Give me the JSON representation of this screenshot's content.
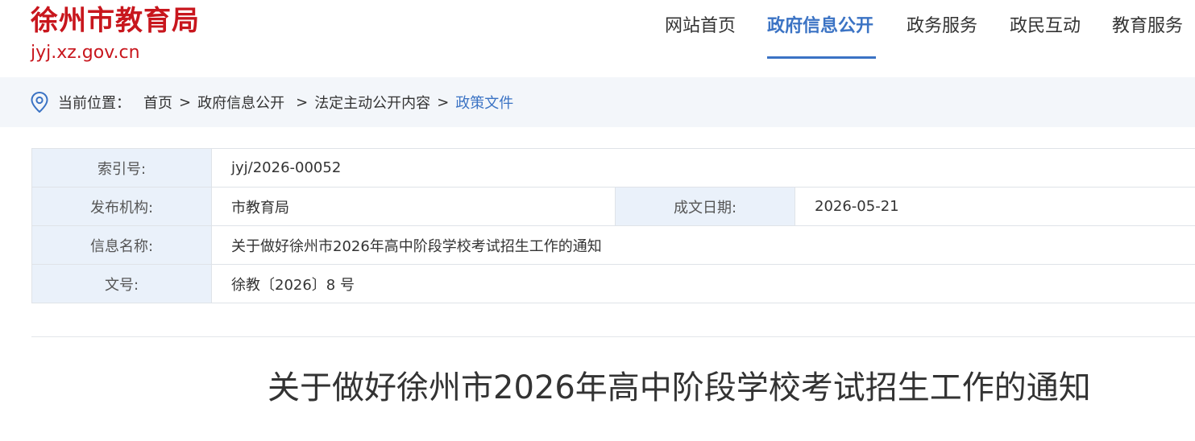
{
  "site": {
    "name": "徐州市教育局",
    "domain": "jyj.xz.gov.cn"
  },
  "nav": {
    "items": [
      {
        "label": "网站首页",
        "active": false
      },
      {
        "label": "政府信息公开",
        "active": true
      },
      {
        "label": "政务服务",
        "active": false
      },
      {
        "label": "政民互动",
        "active": false
      },
      {
        "label": "教育服务",
        "active": false
      }
    ]
  },
  "breadcrumb": {
    "icon": "location-pin-icon",
    "label": "当前位置：",
    "items": [
      "首页",
      "政府信息公开",
      "法定主动公开内容"
    ],
    "separator": ">",
    "current": "政策文件"
  },
  "info": {
    "index_label": "索引号:",
    "index_value": "jyj/2026-00052",
    "publisher_label": "发布机构:",
    "publisher_value": "市教育局",
    "date_label": "成文日期:",
    "date_value": "2026-05-21",
    "name_label": "信息名称:",
    "name_value": "关于做好徐州市2026年高中阶段学校考试招生工作的通知",
    "docno_label": "文号:",
    "docno_value": "徐教〔2026〕8 号"
  },
  "document": {
    "title": "关于做好徐州市2026年高中阶段学校考试招生工作的通知"
  },
  "colors": {
    "brand_red": "#c8161d",
    "accent_blue": "#3b73c4",
    "crumb_bg": "#f3f6fa",
    "label_cell_bg": "#eaf1fa"
  }
}
